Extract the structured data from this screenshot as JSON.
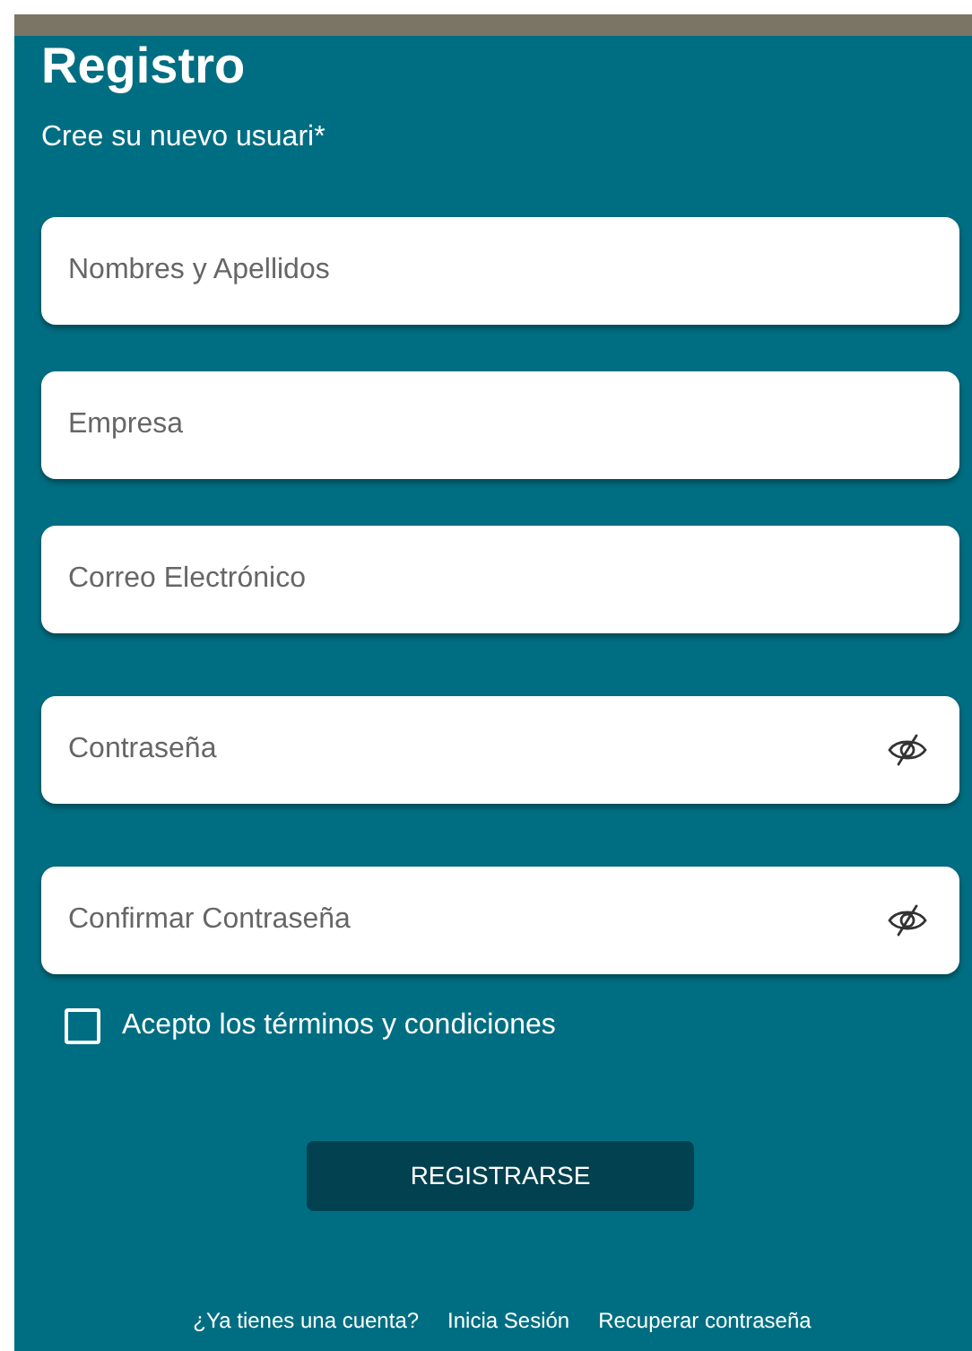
{
  "header": {
    "title": "Registro",
    "subtitle": "Cree su nuevo usuari*"
  },
  "fields": [
    {
      "kind": "text",
      "placeholder": "Nombres y Apellidos"
    },
    {
      "kind": "text",
      "placeholder": "Empresa"
    },
    {
      "kind": "text",
      "placeholder": "Correo Electrónico"
    },
    {
      "kind": "password",
      "placeholder": "Contraseña"
    },
    {
      "kind": "password",
      "placeholder": "Confirmar Contraseña"
    }
  ],
  "terms": {
    "label": "Acepto los términos y condiciones",
    "checked": false
  },
  "submit": {
    "label": "REGISTRARSE"
  },
  "footer": {
    "prompt": "¿Ya tienes una cuenta?",
    "links": [
      "Inicia Sesión",
      "Recuperar contraseña"
    ]
  }
}
